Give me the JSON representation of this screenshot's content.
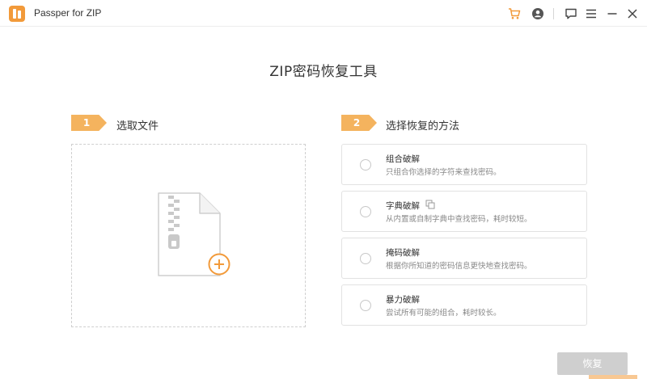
{
  "app": {
    "title": "Passper for ZIP"
  },
  "icons": {
    "cart": "shopping-cart-icon",
    "user": "user-icon",
    "feedback": "feedback-icon",
    "menu": "menu-icon",
    "minimize": "minimize-icon",
    "close": "close-icon",
    "zip_file": "zip-file-icon",
    "add": "add-circle-icon",
    "copy": "copy-icon"
  },
  "colors": {
    "accent": "#f29a3a",
    "badge": "#f4b35e",
    "button_disabled": "#cfcfcf"
  },
  "main": {
    "title": "ZIP密码恢复工具",
    "step1": {
      "number": "1",
      "label": "选取文件"
    },
    "step2": {
      "number": "2",
      "label": "选择恢复的方法"
    },
    "methods": [
      {
        "title": "组合破解",
        "desc": "只组合你选择的字符来查找密码。",
        "selected": false
      },
      {
        "title": "字典破解",
        "desc": "从内置或自制字典中查找密码，耗时较短。",
        "selected": false
      },
      {
        "title": "掩码破解",
        "desc": "根据你所知道的密码信息更快地查找密码。",
        "selected": false
      },
      {
        "title": "暴力破解",
        "desc": "尝试所有可能的组合，耗时较长。",
        "selected": false
      }
    ],
    "recover_button": "恢复"
  }
}
